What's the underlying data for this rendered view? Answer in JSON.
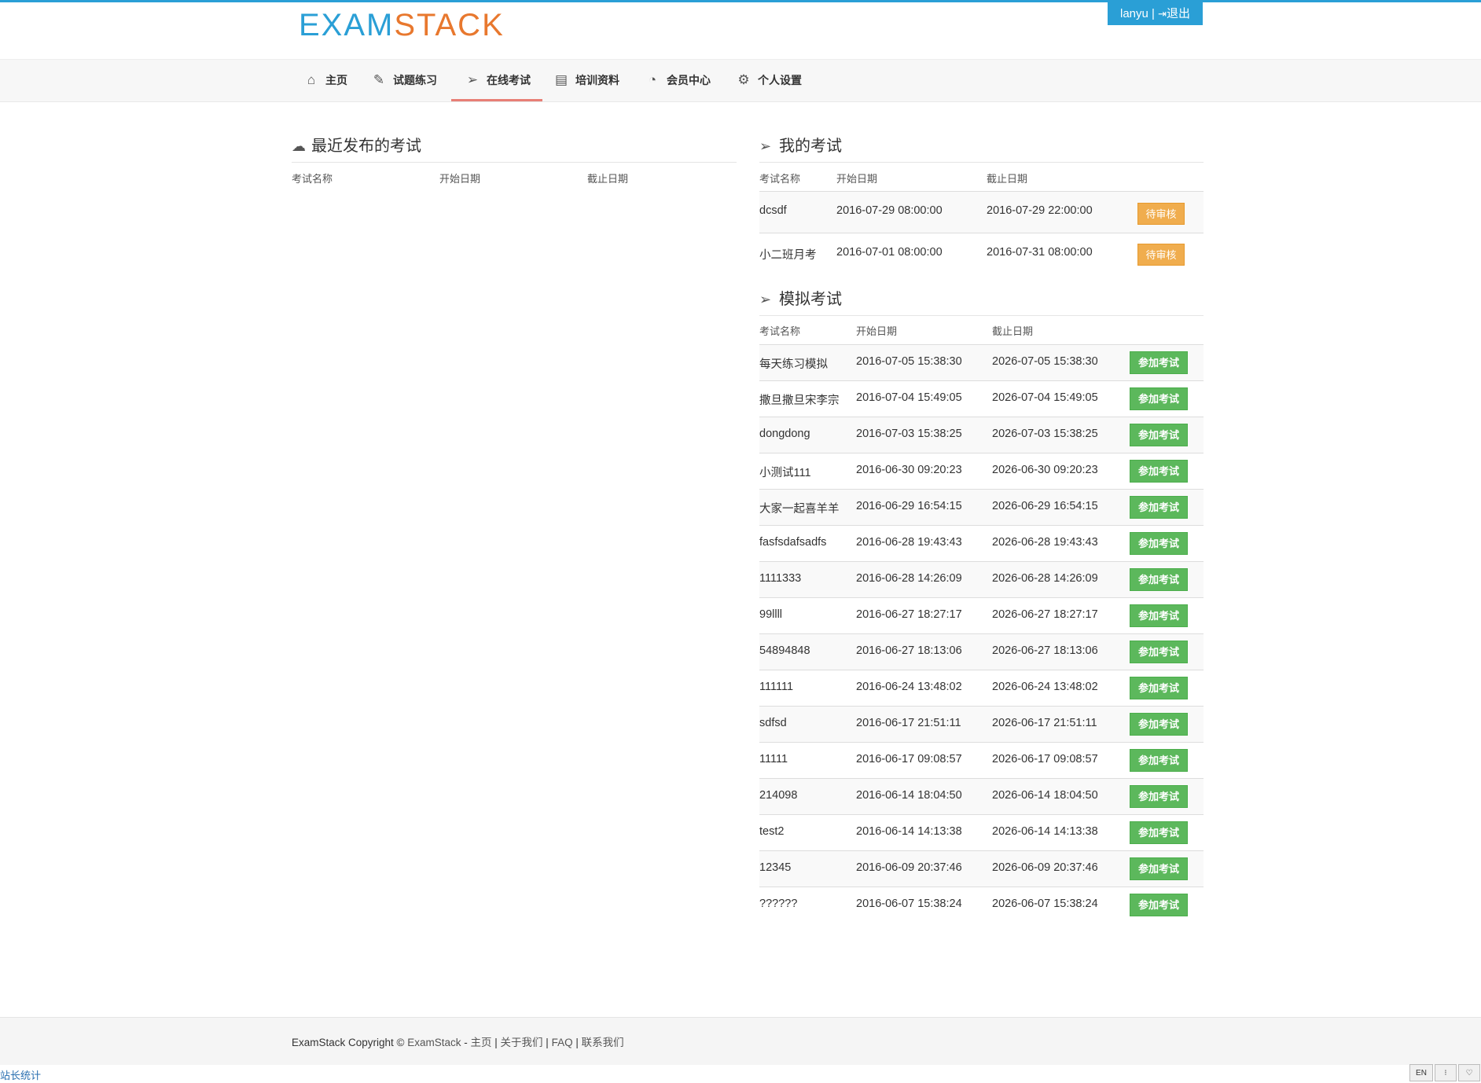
{
  "brand": {
    "logo_part1": "EXAM",
    "logo_part2": "STACK",
    "accent": "#2a9fd6",
    "accent2": "#e8782e"
  },
  "user": {
    "name": "lanyu",
    "separator": " | ",
    "logout_icon": "sign-out-icon",
    "logout_label": "退出"
  },
  "nav": {
    "items": [
      {
        "icon": "home-icon",
        "label": "主页"
      },
      {
        "icon": "edit-icon",
        "label": "试题练习"
      },
      {
        "icon": "paper-plane-icon",
        "label": "在线考试",
        "active": true
      },
      {
        "icon": "book-icon",
        "label": "培训资料"
      },
      {
        "icon": "dashboard-icon",
        "label": "会员中心"
      },
      {
        "icon": "gears-icon",
        "label": "个人设置"
      }
    ]
  },
  "recent": {
    "title": "最近发布的考试",
    "icon": "cloud-upload-icon",
    "headers": [
      "考试名称",
      "开始日期",
      "截止日期"
    ]
  },
  "my_exams": {
    "title": "我的考试",
    "icon": "paper-plane-icon",
    "headers": [
      "考试名称",
      "开始日期",
      "截止日期"
    ],
    "rows": [
      {
        "name": "dcsdf",
        "start": "2016-07-29 08:00:00",
        "end": "2016-07-29 22:00:00",
        "status": "待审核"
      },
      {
        "name": "小二班月考",
        "start": "2016-07-01 08:00:00",
        "end": "2016-07-31 08:00:00",
        "status": "待审核"
      }
    ]
  },
  "mock": {
    "title": "模拟考试",
    "icon": "paper-plane-icon",
    "headers": [
      "考试名称",
      "开始日期",
      "截止日期"
    ],
    "action_label": "参加考试",
    "rows": [
      {
        "name": "每天练习模拟",
        "start": "2016-07-05 15:38:30",
        "end": "2026-07-05 15:38:30"
      },
      {
        "name": "撒旦撒旦宋李宗",
        "start": "2016-07-04 15:49:05",
        "end": "2026-07-04 15:49:05"
      },
      {
        "name": "dongdong",
        "start": "2016-07-03 15:38:25",
        "end": "2026-07-03 15:38:25"
      },
      {
        "name": "小测试111",
        "start": "2016-06-30 09:20:23",
        "end": "2026-06-30 09:20:23"
      },
      {
        "name": "大家一起喜羊羊",
        "start": "2016-06-29 16:54:15",
        "end": "2026-06-29 16:54:15"
      },
      {
        "name": "fasfsdafsadfs",
        "start": "2016-06-28 19:43:43",
        "end": "2026-06-28 19:43:43"
      },
      {
        "name": "1111333",
        "start": "2016-06-28 14:26:09",
        "end": "2026-06-28 14:26:09"
      },
      {
        "name": "99llll",
        "start": "2016-06-27 18:27:17",
        "end": "2026-06-27 18:27:17"
      },
      {
        "name": "54894848",
        "start": "2016-06-27 18:13:06",
        "end": "2026-06-27 18:13:06"
      },
      {
        "name": "111111",
        "start": "2016-06-24 13:48:02",
        "end": "2026-06-24 13:48:02"
      },
      {
        "name": "sdfsd",
        "start": "2016-06-17 21:51:11",
        "end": "2026-06-17 21:51:11"
      },
      {
        "name": "11111",
        "start": "2016-06-17 09:08:57",
        "end": "2026-06-17 09:08:57"
      },
      {
        "name": "214098",
        "start": "2016-06-14 18:04:50",
        "end": "2026-06-14 18:04:50"
      },
      {
        "name": "test2",
        "start": "2016-06-14 14:13:38",
        "end": "2026-06-14 14:13:38"
      },
      {
        "name": "12345",
        "start": "2016-06-09 20:37:46",
        "end": "2026-06-09 20:37:46"
      },
      {
        "name": "??????",
        "start": "2016-06-07 15:38:24",
        "end": "2026-06-07 15:38:24"
      }
    ]
  },
  "footer": {
    "copyright": "ExamStack Copyright © ",
    "brand_link": "ExamStack",
    "dash": " - ",
    "links": [
      "主页",
      "关于我们",
      "FAQ",
      "联系我们"
    ],
    "sep": " | "
  },
  "stats_link": "站长统计",
  "tray": [
    "EN",
    "⁝",
    "♡"
  ]
}
